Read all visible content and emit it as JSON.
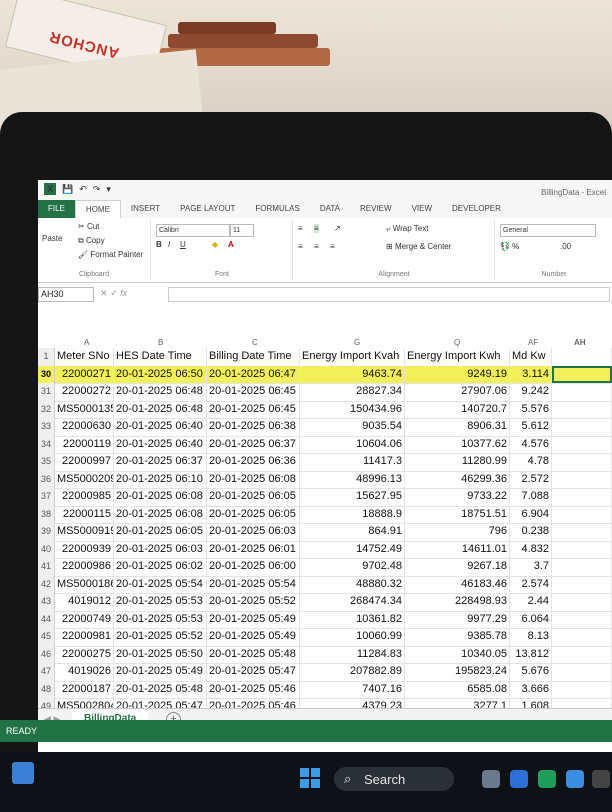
{
  "titlebar": {
    "logo": "X",
    "title": "BillingData - Excel"
  },
  "box_brand": "ANCHOR",
  "tabs": [
    "FILE",
    "HOME",
    "INSERT",
    "PAGE LAYOUT",
    "FORMULAS",
    "DATA",
    "REVIEW",
    "VIEW",
    "DEVELOPER"
  ],
  "ribbon": {
    "clipboard": {
      "cut": "Cut",
      "copy": "Copy",
      "paste": "Paste",
      "format_painter": "Format Painter",
      "label": "Clipboard"
    },
    "font": {
      "name": "Calibri",
      "size": "11",
      "label": "Font"
    },
    "alignment": {
      "wrap": "Wrap Text",
      "merge": "Merge & Center",
      "label": "Alignment"
    },
    "number": {
      "format": "General",
      "label": "Number"
    }
  },
  "formula_bar": {
    "name_box": "AH30",
    "fx": "fx",
    "value": ""
  },
  "columns": {
    "a": "A",
    "b": "B",
    "c": "C",
    "g": "G",
    "q": "Q",
    "af": "AF",
    "ah": "AH"
  },
  "header_row": {
    "rn": "1",
    "a": "Meter SNo",
    "b": "HES Date Time",
    "c": "Billing Date Time",
    "g": "Energy Import Kvah",
    "q": "Energy Import Kwh",
    "af": "Md Kw",
    "ah": ""
  },
  "rows": [
    {
      "rn": "30",
      "a": "22000271",
      "b": "20-01-2025 06:50",
      "c": "20-01-2025 06:47",
      "g": "9463.74",
      "q": "9249.19",
      "af": "3.114"
    },
    {
      "rn": "31",
      "a": "22000272",
      "b": "20-01-2025 06:48",
      "c": "20-01-2025 06:45",
      "g": "28827.34",
      "q": "27907.06",
      "af": "9.242"
    },
    {
      "rn": "32",
      "a": "MS5000135",
      "b": "20-01-2025 06:48",
      "c": "20-01-2025 06:45",
      "g": "150434.96",
      "q": "140720.7",
      "af": "5.576"
    },
    {
      "rn": "33",
      "a": "22000630",
      "b": "20-01-2025 06:40",
      "c": "20-01-2025 06:38",
      "g": "9035.54",
      "q": "8906.31",
      "af": "5.612"
    },
    {
      "rn": "34",
      "a": "22000119",
      "b": "20-01-2025 06:40",
      "c": "20-01-2025 06:37",
      "g": "10604.06",
      "q": "10377.62",
      "af": "4.576"
    },
    {
      "rn": "35",
      "a": "22000997",
      "b": "20-01-2025 06:37",
      "c": "20-01-2025 06:36",
      "g": "11417.3",
      "q": "11280.99",
      "af": "4.78"
    },
    {
      "rn": "36",
      "a": "MS5000209",
      "b": "20-01-2025 06:10",
      "c": "20-01-2025 06:08",
      "g": "48996.13",
      "q": "46299.36",
      "af": "2.572"
    },
    {
      "rn": "37",
      "a": "22000985",
      "b": "20-01-2025 06:08",
      "c": "20-01-2025 06:05",
      "g": "15627.95",
      "q": "9733.22",
      "af": "7.088"
    },
    {
      "rn": "38",
      "a": "22000115",
      "b": "20-01-2025 06:08",
      "c": "20-01-2025 06:05",
      "g": "18888.9",
      "q": "18751.51",
      "af": "6.904"
    },
    {
      "rn": "39",
      "a": "MS5000919",
      "b": "20-01-2025 06:05",
      "c": "20-01-2025 06:03",
      "g": "864.91",
      "q": "796",
      "af": "0.238"
    },
    {
      "rn": "40",
      "a": "22000939",
      "b": "20-01-2025 06:03",
      "c": "20-01-2025 06:01",
      "g": "14752.49",
      "q": "14611.01",
      "af": "4.832"
    },
    {
      "rn": "41",
      "a": "22000986",
      "b": "20-01-2025 06:02",
      "c": "20-01-2025 06:00",
      "g": "9702.48",
      "q": "9267.18",
      "af": "3.7"
    },
    {
      "rn": "42",
      "a": "MS5000186",
      "b": "20-01-2025 05:54",
      "c": "20-01-2025 05:54",
      "g": "48880.32",
      "q": "46183.46",
      "af": "2.574"
    },
    {
      "rn": "43",
      "a": "4019012",
      "b": "20-01-2025 05:53",
      "c": "20-01-2025 05:52",
      "g": "268474.34",
      "q": "228498.93",
      "af": "2.44"
    },
    {
      "rn": "44",
      "a": "22000749",
      "b": "20-01-2025 05:53",
      "c": "20-01-2025 05:49",
      "g": "10361.82",
      "q": "9977.29",
      "af": "6.064"
    },
    {
      "rn": "45",
      "a": "22000981",
      "b": "20-01-2025 05:52",
      "c": "20-01-2025 05:49",
      "g": "10060.99",
      "q": "9385.78",
      "af": "8.13"
    },
    {
      "rn": "46",
      "a": "22000275",
      "b": "20-01-2025 05:50",
      "c": "20-01-2025 05:48",
      "g": "11284.83",
      "q": "10340.05",
      "af": "13.812"
    },
    {
      "rn": "47",
      "a": "4019026",
      "b": "20-01-2025 05:49",
      "c": "20-01-2025 05:47",
      "g": "207882.89",
      "q": "195823.24",
      "af": "5.676"
    },
    {
      "rn": "48",
      "a": "22000187",
      "b": "20-01-2025 05:48",
      "c": "20-01-2025 05:46",
      "g": "7407.16",
      "q": "6585.08",
      "af": "3.666"
    },
    {
      "rn": "49",
      "a": "MS5002804",
      "b": "20-01-2025 05:47",
      "c": "20-01-2025 05:46",
      "g": "4379.23",
      "q": "3277.1",
      "af": "1.608"
    }
  ],
  "sheet_tab": "BillingData",
  "status": "READY",
  "taskbar": {
    "search": "Search"
  },
  "colors": {
    "excel_green": "#217346",
    "highlight": "#f1ef5a"
  }
}
